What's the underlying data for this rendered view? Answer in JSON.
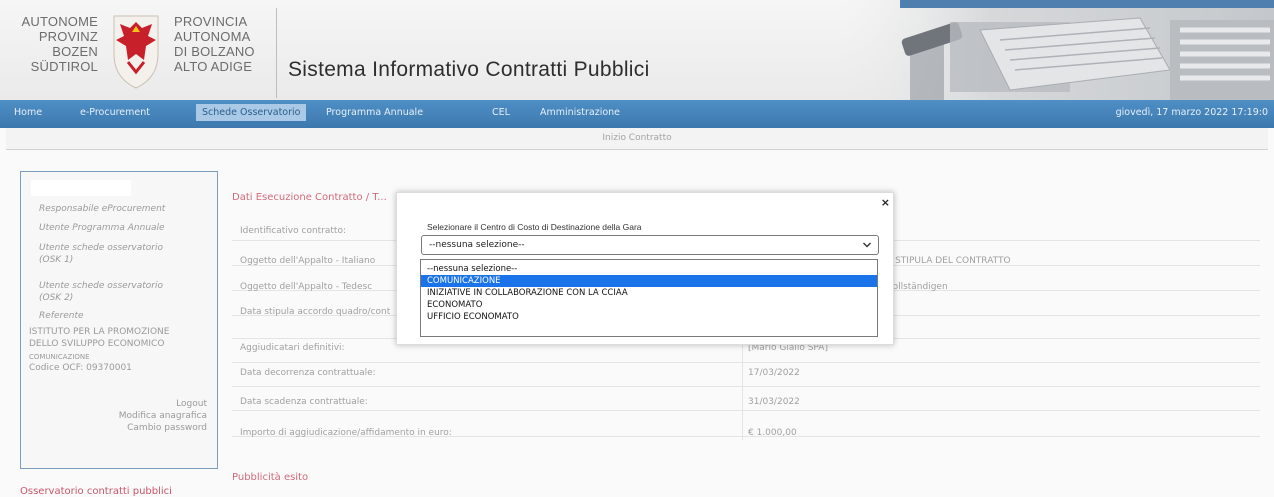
{
  "header": {
    "logo_left_lines": [
      "AUTONOME",
      "PROVINZ",
      "BOZEN",
      "SÜDTIROL"
    ],
    "logo_right_lines": [
      "PROVINCIA",
      "AUTONOMA",
      "DI BOLZANO",
      "ALTO ADIGE"
    ],
    "app_title": "Sistema Informativo Contratti Pubblici"
  },
  "nav": {
    "items": [
      "Home",
      "e-Procurement",
      "Schede Osservatorio",
      "Programma Annuale",
      "CEL",
      "Amministrazione"
    ],
    "active_index": 2,
    "datetime": "giovedì, 17 marzo 2022 17:19:0"
  },
  "subbar": {
    "title": "Inizio Contratto"
  },
  "sidebar": {
    "links": [
      "Responsabile eProcurement",
      "Utente Programma Annuale",
      "Utente schede osservatorio",
      "(OSK 1)",
      "Utente schede osservatorio",
      "(OSK 2)",
      "Referente"
    ],
    "organization_lines": [
      "ISTITUTO PER LA PROMOZIONE",
      "DELLO SVILUPPO ECONOMICO"
    ],
    "organization_unit": "COMUNICAZIONE",
    "fiscal_code": "Codice OCF: 09370001",
    "actions": [
      "Logout",
      "Modifica anagrafica",
      "Cambio password"
    ]
  },
  "sidebar_next_section": "Osservatorio contratti pubblici",
  "main": {
    "section_title": "Dati Esecuzione Contratto / T...",
    "rows": [
      {
        "label": "Identificativo contratto:",
        "value": ""
      },
      {
        "label": "Oggetto dell'Appalto - Italiano",
        "value": "",
        "tail": "E E STIPULA DEL CONTRATTO"
      },
      {
        "label": "Oggetto dell'Appalto - Tedesc",
        "value": "",
        "tail": "ervollständigen"
      },
      {
        "label": "Data stipula accordo quadro/cont",
        "value": ""
      },
      {
        "label": "Aggiudicatari definitivi:",
        "value": "[Mario Giallo SPA]"
      },
      {
        "label": "Data decorrenza contrattuale:",
        "value": "17/03/2022"
      },
      {
        "label": "Data scadenza contrattuale:",
        "value": "31/03/2022"
      },
      {
        "label": "Importo di aggiudicazione/affidamento in euro:",
        "value": "€ 1.000,00"
      }
    ],
    "next_section": "Pubblicità esito"
  },
  "modal": {
    "close_glyph": "×",
    "label": "Selezionare il Centro di Costo di Destinazione della Gara",
    "select_value": "--nessuna selezione--",
    "options": [
      "--nessuna selezione--",
      "COMUNICAZIONE",
      "INIZIATIVE IN COLLABORAZIONE CON LA CCIAA",
      "ECONOMATO",
      "UFFICIO ECONOMATO"
    ],
    "highlighted_index": 1
  },
  "colors": {
    "nav_bar": "#3c78ad",
    "accent_title": "#d06a78",
    "dropdown_highlight": "#1a73e8"
  }
}
